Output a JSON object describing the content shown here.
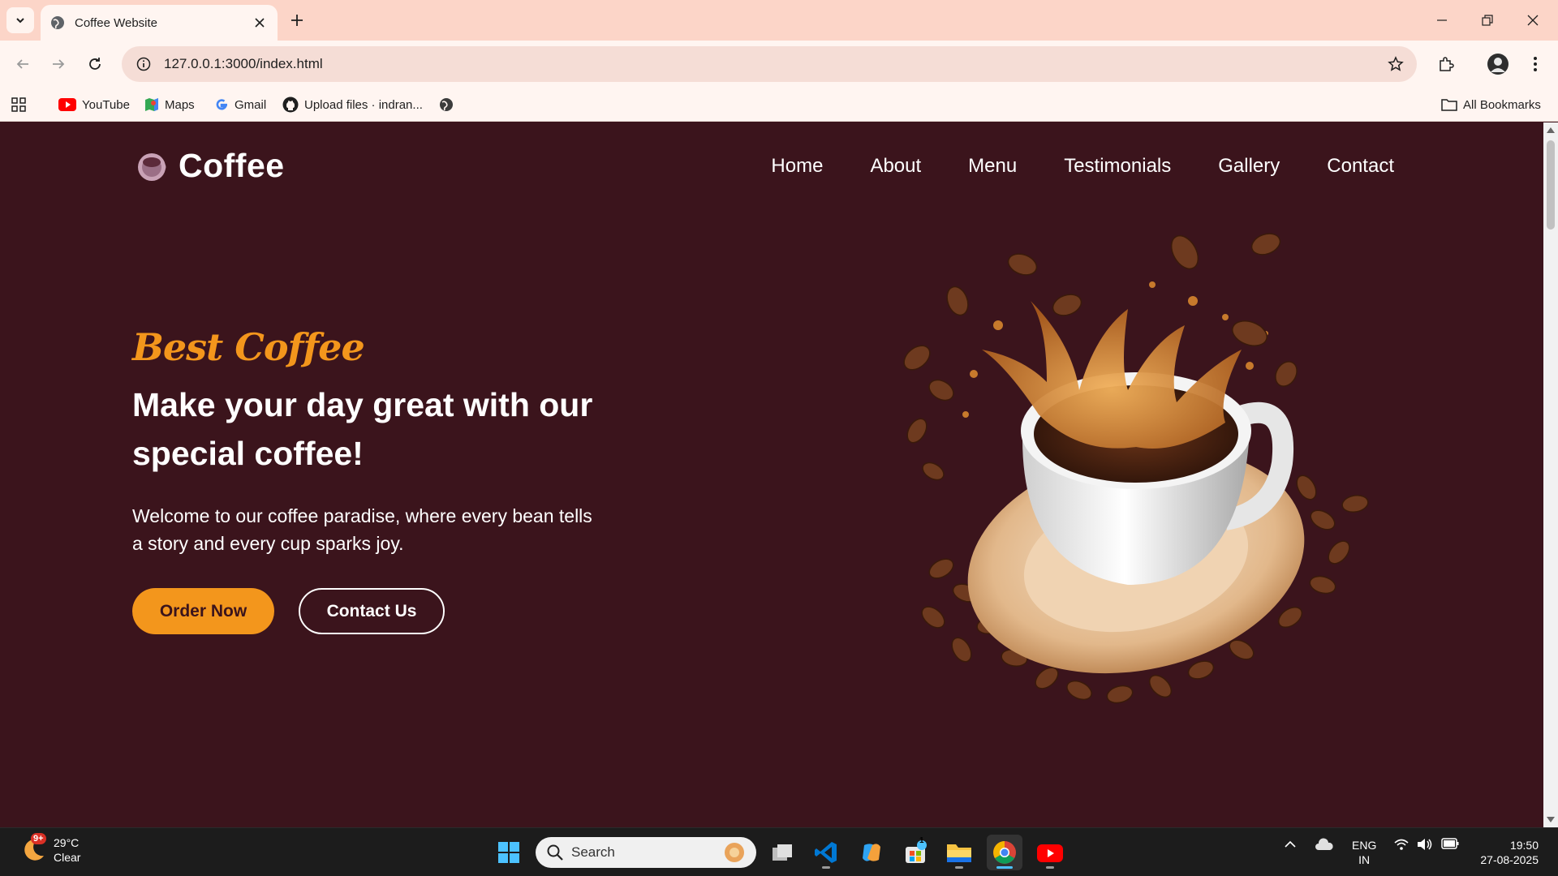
{
  "browser": {
    "tab_title": "Coffee Website",
    "url": "127.0.0.1:3000/index.html",
    "bookmarks": [
      {
        "label": "YouTube",
        "icon": "youtube-icon"
      },
      {
        "label": "Maps",
        "icon": "maps-icon"
      },
      {
        "label": "Gmail",
        "icon": "google-icon"
      },
      {
        "label": "Upload files · indran...",
        "icon": "github-icon"
      }
    ],
    "all_bookmarks": "All Bookmarks"
  },
  "site": {
    "logo": "Coffee",
    "nav": [
      "Home",
      "About",
      "Menu",
      "Testimonials",
      "Gallery",
      "Contact"
    ],
    "hero": {
      "subtitle": "Best Coffee",
      "heading_line1": "Make your day great with our",
      "heading_line2": "special coffee!",
      "description_line1": "Welcome to our coffee paradise, where every bean tells",
      "description_line2": "a story and every cup sparks joy.",
      "order_button": "Order Now",
      "contact_button": "Contact Us"
    },
    "colors": {
      "background": "#3b141c",
      "accent": "#f3961c",
      "text": "#ffffff"
    }
  },
  "taskbar": {
    "weather_badge": "9+",
    "temperature": "29°C",
    "condition": "Clear",
    "search_placeholder": "Search",
    "store_badge": "1",
    "lang_line1": "ENG",
    "lang_line2": "IN",
    "time": "19:50",
    "date": "27-08-2025"
  }
}
